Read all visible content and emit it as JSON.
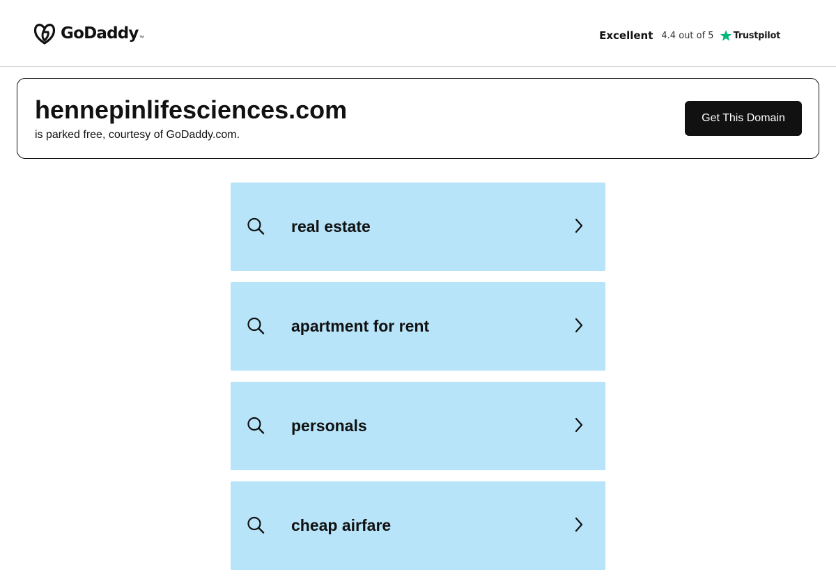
{
  "header": {
    "brand": "GoDaddy",
    "brand_tm": "™",
    "rating": {
      "label": "Excellent",
      "score_text": "4.4 out of 5",
      "provider": "Trustpilot",
      "star_color": "#00b67a"
    }
  },
  "domain_card": {
    "domain": "hennepinlifesciences.com",
    "subtitle": "is parked free, courtesy of GoDaddy.com.",
    "cta_label": "Get This Domain"
  },
  "search_links": {
    "background_color": "#b7e4f9",
    "items": [
      {
        "label": "real estate",
        "icon": "search-icon",
        "chevron": "chevron-right-icon"
      },
      {
        "label": "apartment for rent",
        "icon": "search-icon",
        "chevron": "chevron-right-icon"
      },
      {
        "label": "personals",
        "icon": "search-icon",
        "chevron": "chevron-right-icon"
      },
      {
        "label": "cheap airfare",
        "icon": "search-icon",
        "chevron": "chevron-right-icon"
      }
    ]
  }
}
